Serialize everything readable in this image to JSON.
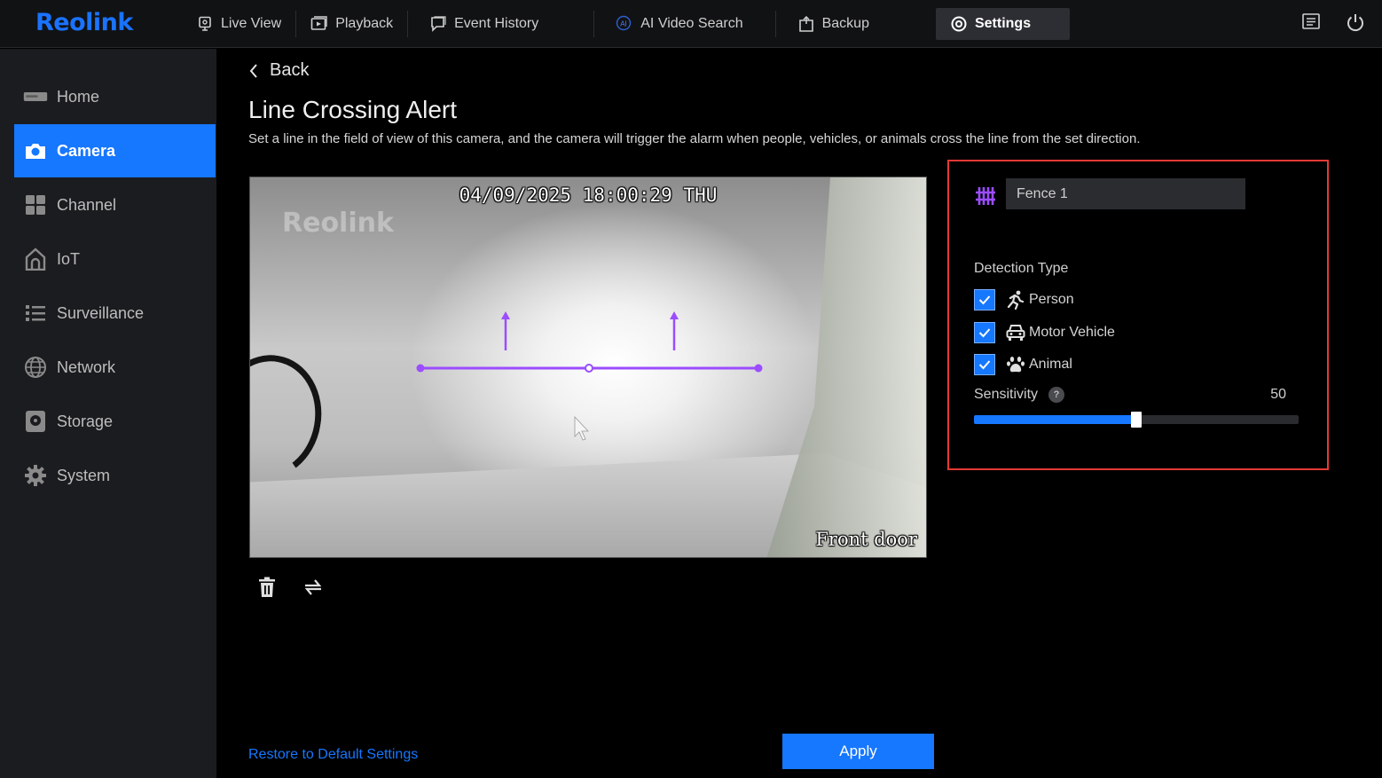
{
  "app": {
    "logo": "Reolink",
    "brand_color": "#1677ff",
    "alert_border_color": "#e53935",
    "line_color": "#9b4dff"
  },
  "topnav": {
    "items": [
      {
        "label": "Live View",
        "icon": "monitor-icon"
      },
      {
        "label": "Playback",
        "icon": "playback-icon"
      },
      {
        "label": "Event History",
        "icon": "event-history-icon"
      },
      {
        "label": "AI Video Search",
        "icon": "ai-search-icon"
      },
      {
        "label": "Backup",
        "icon": "backup-icon"
      },
      {
        "label": "Settings",
        "icon": "gear-icon",
        "active": true
      }
    ],
    "right_icons": [
      "message-icon",
      "power-icon"
    ]
  },
  "sidebar": {
    "items": [
      {
        "label": "Home",
        "icon": "home-device-icon"
      },
      {
        "label": "Camera",
        "icon": "camera-icon",
        "active": true
      },
      {
        "label": "Channel",
        "icon": "channel-grid-icon"
      },
      {
        "label": "IoT",
        "icon": "iot-house-icon"
      },
      {
        "label": "Surveillance",
        "icon": "list-icon"
      },
      {
        "label": "Network",
        "icon": "globe-icon"
      },
      {
        "label": "Storage",
        "icon": "storage-icon"
      },
      {
        "label": "System",
        "icon": "gear-icon"
      }
    ]
  },
  "main": {
    "back_label": "Back",
    "title": "Line Crossing Alert",
    "description": "Set a line in the field of view of this camera, and the camera will trigger the alarm when people, vehicles, or animals cross the line from the set direction."
  },
  "camera": {
    "osd_time": "04/09/2025  18:00:29 THU",
    "watermark": "Reolink",
    "osd_name": "Front door"
  },
  "tools": {
    "icons": [
      "trash-icon",
      "swap-direction-icon"
    ]
  },
  "panel": {
    "fence_name": "Fence 1",
    "detection_type_label": "Detection Type",
    "detection_types": [
      {
        "label": "Person",
        "icon": "person-running-icon",
        "checked": true
      },
      {
        "label": "Motor Vehicle",
        "icon": "car-icon",
        "checked": true
      },
      {
        "label": "Animal",
        "icon": "paw-icon",
        "checked": true
      }
    ],
    "sensitivity_label": "Sensitivity",
    "help_glyph": "?",
    "sensitivity_value": "50",
    "sensitivity_max": 100
  },
  "footer": {
    "restore_label": "Restore to Default Settings",
    "apply_label": "Apply"
  }
}
